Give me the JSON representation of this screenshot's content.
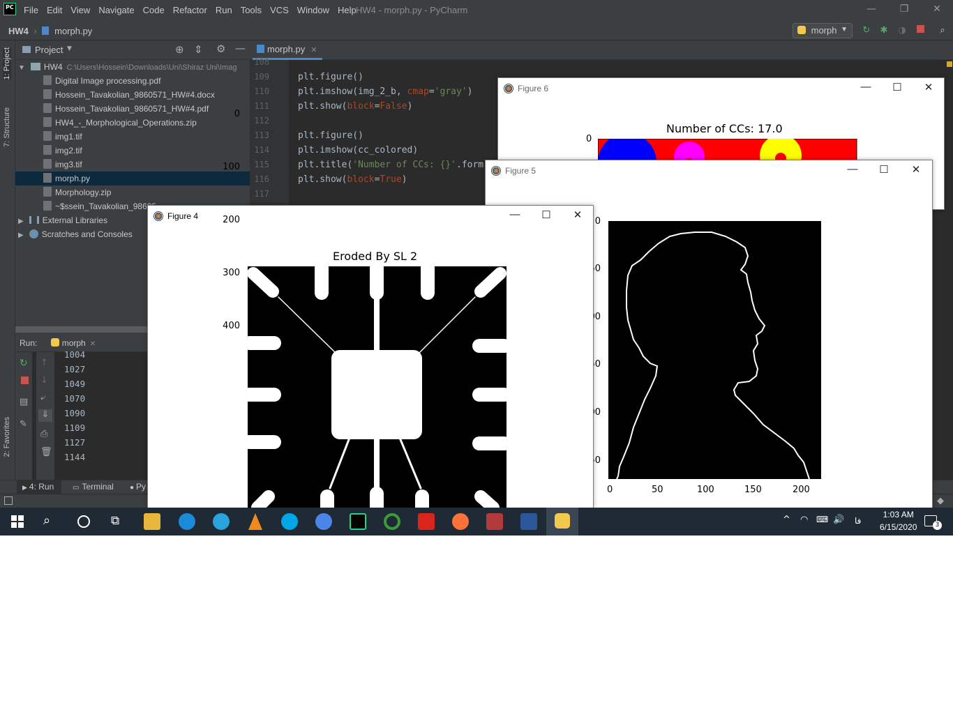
{
  "window": {
    "title": "HW4 - morph.py - PyCharm",
    "menu": [
      "File",
      "Edit",
      "View",
      "Navigate",
      "Code",
      "Refactor",
      "Run",
      "Tools",
      "VCS",
      "Window",
      "Help"
    ],
    "logo": "PC"
  },
  "navbar": {
    "project": "HW4",
    "file": "morph.py",
    "run_config": "morph"
  },
  "sidebar_tabs": {
    "project": "1: Project",
    "structure": "7: Structure",
    "favorites": "2: Favorites"
  },
  "project_panel": {
    "header": "Project",
    "root": "HW4",
    "root_path": "C:\\Users\\Hossein\\Downloads\\Uni\\Shiraz Uni\\Imag",
    "files": [
      "Digital Image processing.pdf",
      "Hossein_Tavakolian_9860571_HW#4.docx",
      "Hossein_Tavakolian_9860571_HW#4.pdf",
      "HW4_-_Morphological_Operations.zip",
      "img1.tif",
      "img2.tif",
      "img3.tif",
      "morph.py",
      "Morphology.zip",
      "~$ssein_Tavakolian_98605"
    ],
    "selected_index": 7,
    "external": "External Libraries",
    "scratches": "Scratches and Consoles"
  },
  "editor": {
    "tab": "morph.py",
    "lines": [
      {
        "n": "108",
        "code": ""
      },
      {
        "n": "109",
        "code": "plt.figure()"
      },
      {
        "n": "110",
        "code": "plt.imshow(img_2_b, cmap='gray')"
      },
      {
        "n": "111",
        "code": "plt.show(block=False)"
      },
      {
        "n": "112",
        "code": ""
      },
      {
        "n": "113",
        "code": "plt.figure()"
      },
      {
        "n": "114",
        "code": "plt.imshow(cc_colored)"
      },
      {
        "n": "115",
        "code": "plt.title('Number of CCs: {}'.form"
      },
      {
        "n": "116",
        "code": "plt.show(block=True)"
      },
      {
        "n": "117",
        "code": ""
      }
    ]
  },
  "run_panel": {
    "label": "Run:",
    "config": "morph",
    "output": [
      "1004",
      "1027",
      "1049",
      "1070",
      "1090",
      "1109",
      "1127",
      "1144"
    ]
  },
  "bottom_tabs": [
    "4: Run",
    "Terminal",
    "Py"
  ],
  "figure6": {
    "title": "Figure 6",
    "plot_title": "Number of CCs: 17.0",
    "y_tick": "0"
  },
  "figure5": {
    "title": "Figure 5",
    "x_ticks": [
      "0",
      "50",
      "100",
      "150",
      "200"
    ],
    "y_ticks": [
      "0",
      "50",
      "00",
      "50",
      "00",
      "50"
    ]
  },
  "figure4": {
    "title": "Figure 4",
    "plot_title": "Eroded By SL 2",
    "y_ticks": [
      "0",
      "100",
      "200",
      "300",
      "400"
    ]
  },
  "taskbar": {
    "time": "1:03 AM",
    "date": "6/15/2020",
    "lang": "فا",
    "notifications": "3"
  }
}
